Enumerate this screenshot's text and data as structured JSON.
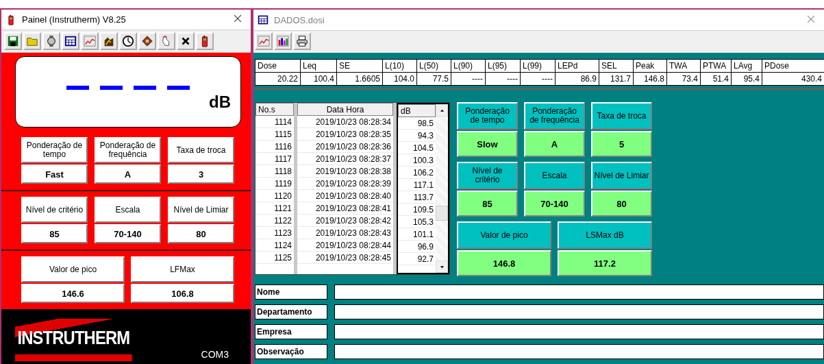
{
  "panel_window": {
    "title": "Painel (Instrutherm) V8.25",
    "display_unit": "dB",
    "setting_groups": [
      [
        {
          "label": "Ponderação de tempo",
          "value": "Fast"
        },
        {
          "label": "Ponderação de frequência",
          "value": "A"
        },
        {
          "label": "Taxa de troca",
          "value": "3"
        }
      ],
      [
        {
          "label": "Nível de critério",
          "value": "85"
        },
        {
          "label": "Escala",
          "value": "70-140"
        },
        {
          "label": "Nível de Limiar",
          "value": "80"
        }
      ],
      [
        {
          "label": "Valor de pico",
          "value": "146.6"
        },
        {
          "label": "LFMax",
          "value": "106.8"
        }
      ]
    ],
    "logo": "INSTRUTHERM",
    "port": "COM3"
  },
  "data_window": {
    "title": "DADOS.dosi",
    "summary": {
      "columns": [
        "Dose",
        "Leq",
        "SE",
        "L(10)",
        "L(50)",
        "L(90)",
        "L(95)",
        "L(99)",
        "LEPd",
        "SEL",
        "Peak",
        "TWA",
        "PTWA",
        "LAvg",
        "PDose"
      ],
      "values": [
        "20.22",
        "100.4",
        "1.6605",
        "104.0",
        "77.5",
        "----",
        "----",
        "----",
        "86.9",
        "131.7",
        "146.8",
        "73.4",
        "51.4",
        "95.4",
        "430.4"
      ]
    },
    "records": {
      "columns": [
        "No.s",
        "Data Hora",
        "dB"
      ],
      "rows": [
        [
          "1114",
          "2019/10/23 08:28:34",
          "98.5"
        ],
        [
          "1115",
          "2019/10/23 08:28:35",
          "94.3"
        ],
        [
          "1116",
          "2019/10/23 08:28:36",
          "104.5"
        ],
        [
          "1117",
          "2019/10/23 08:28:37",
          "100.3"
        ],
        [
          "1118",
          "2019/10/23 08:28:38",
          "106.2"
        ],
        [
          "1119",
          "2019/10/23 08:28:39",
          "117.1"
        ],
        [
          "1120",
          "2019/10/23 08:28:40",
          "113.7"
        ],
        [
          "1121",
          "2019/10/23 08:28:41",
          "109.5"
        ],
        [
          "1122",
          "2019/10/23 08:28:42",
          "105.3"
        ],
        [
          "1123",
          "2019/10/23 08:28:43",
          "101.1"
        ],
        [
          "1124",
          "2019/10/23 08:28:44",
          "96.9"
        ],
        [
          "1125",
          "2019/10/23 08:28:45",
          "92.7"
        ]
      ]
    },
    "setting_groups": [
      [
        {
          "label": "Ponderação de tempo",
          "value": "Slow"
        },
        {
          "label": "Ponderação de frequência",
          "value": "A"
        },
        {
          "label": "Taxa de troca",
          "value": "5"
        }
      ],
      [
        {
          "label": "Nível de critério",
          "value": "85"
        },
        {
          "label": "Escala",
          "value": "70-140"
        },
        {
          "label": "Nível de Limiar",
          "value": "80"
        }
      ],
      [
        {
          "label": "Valor de pico",
          "value": "146.8"
        },
        {
          "label": "LSMax dB",
          "value": "117.2"
        }
      ]
    ],
    "form": [
      {
        "label": "Nome"
      },
      {
        "label": "Departamento"
      },
      {
        "label": "Empresa"
      },
      {
        "label": "Observação"
      }
    ]
  }
}
